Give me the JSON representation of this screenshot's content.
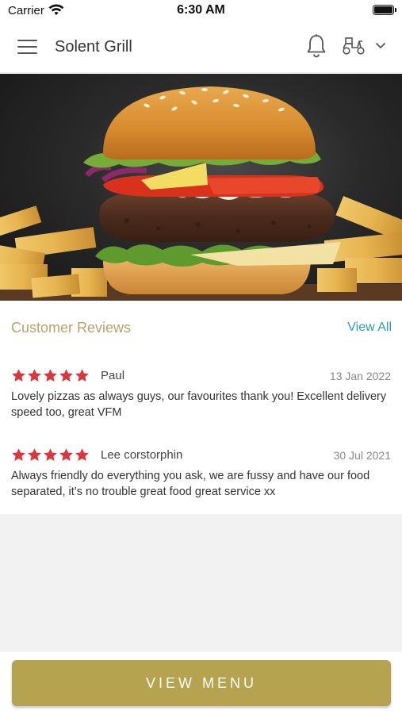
{
  "status_bar": {
    "carrier": "Carrier",
    "time": "6:30 AM"
  },
  "header": {
    "title": "Solent Grill",
    "icons": [
      "menu-icon",
      "bell-icon",
      "scooter-icon",
      "chevron-down-icon"
    ]
  },
  "hero": {
    "image": "burger-and-fries-photo"
  },
  "reviews": {
    "title": "Customer Reviews",
    "view_all_label": "View All",
    "items": [
      {
        "rating": 5,
        "name": "Paul",
        "date": "13 Jan 2022",
        "text": "Lovely pizzas as always guys, our favourites thank you! Excellent delivery speed too, great VFM"
      },
      {
        "rating": 5,
        "name": "Lee corstorphin",
        "date": "30 Jul 2021",
        "text": "Always friendly do everything you ask, we are fussy and have our food separated, it’s no trouble great food great service xx"
      }
    ]
  },
  "footer": {
    "view_menu_label": "VIEW MENU"
  },
  "colors": {
    "accent_gold": "#b5a350",
    "title_gold": "#b5a36a",
    "link_blue": "#2a9bc5",
    "star_red": "#d9363e"
  }
}
